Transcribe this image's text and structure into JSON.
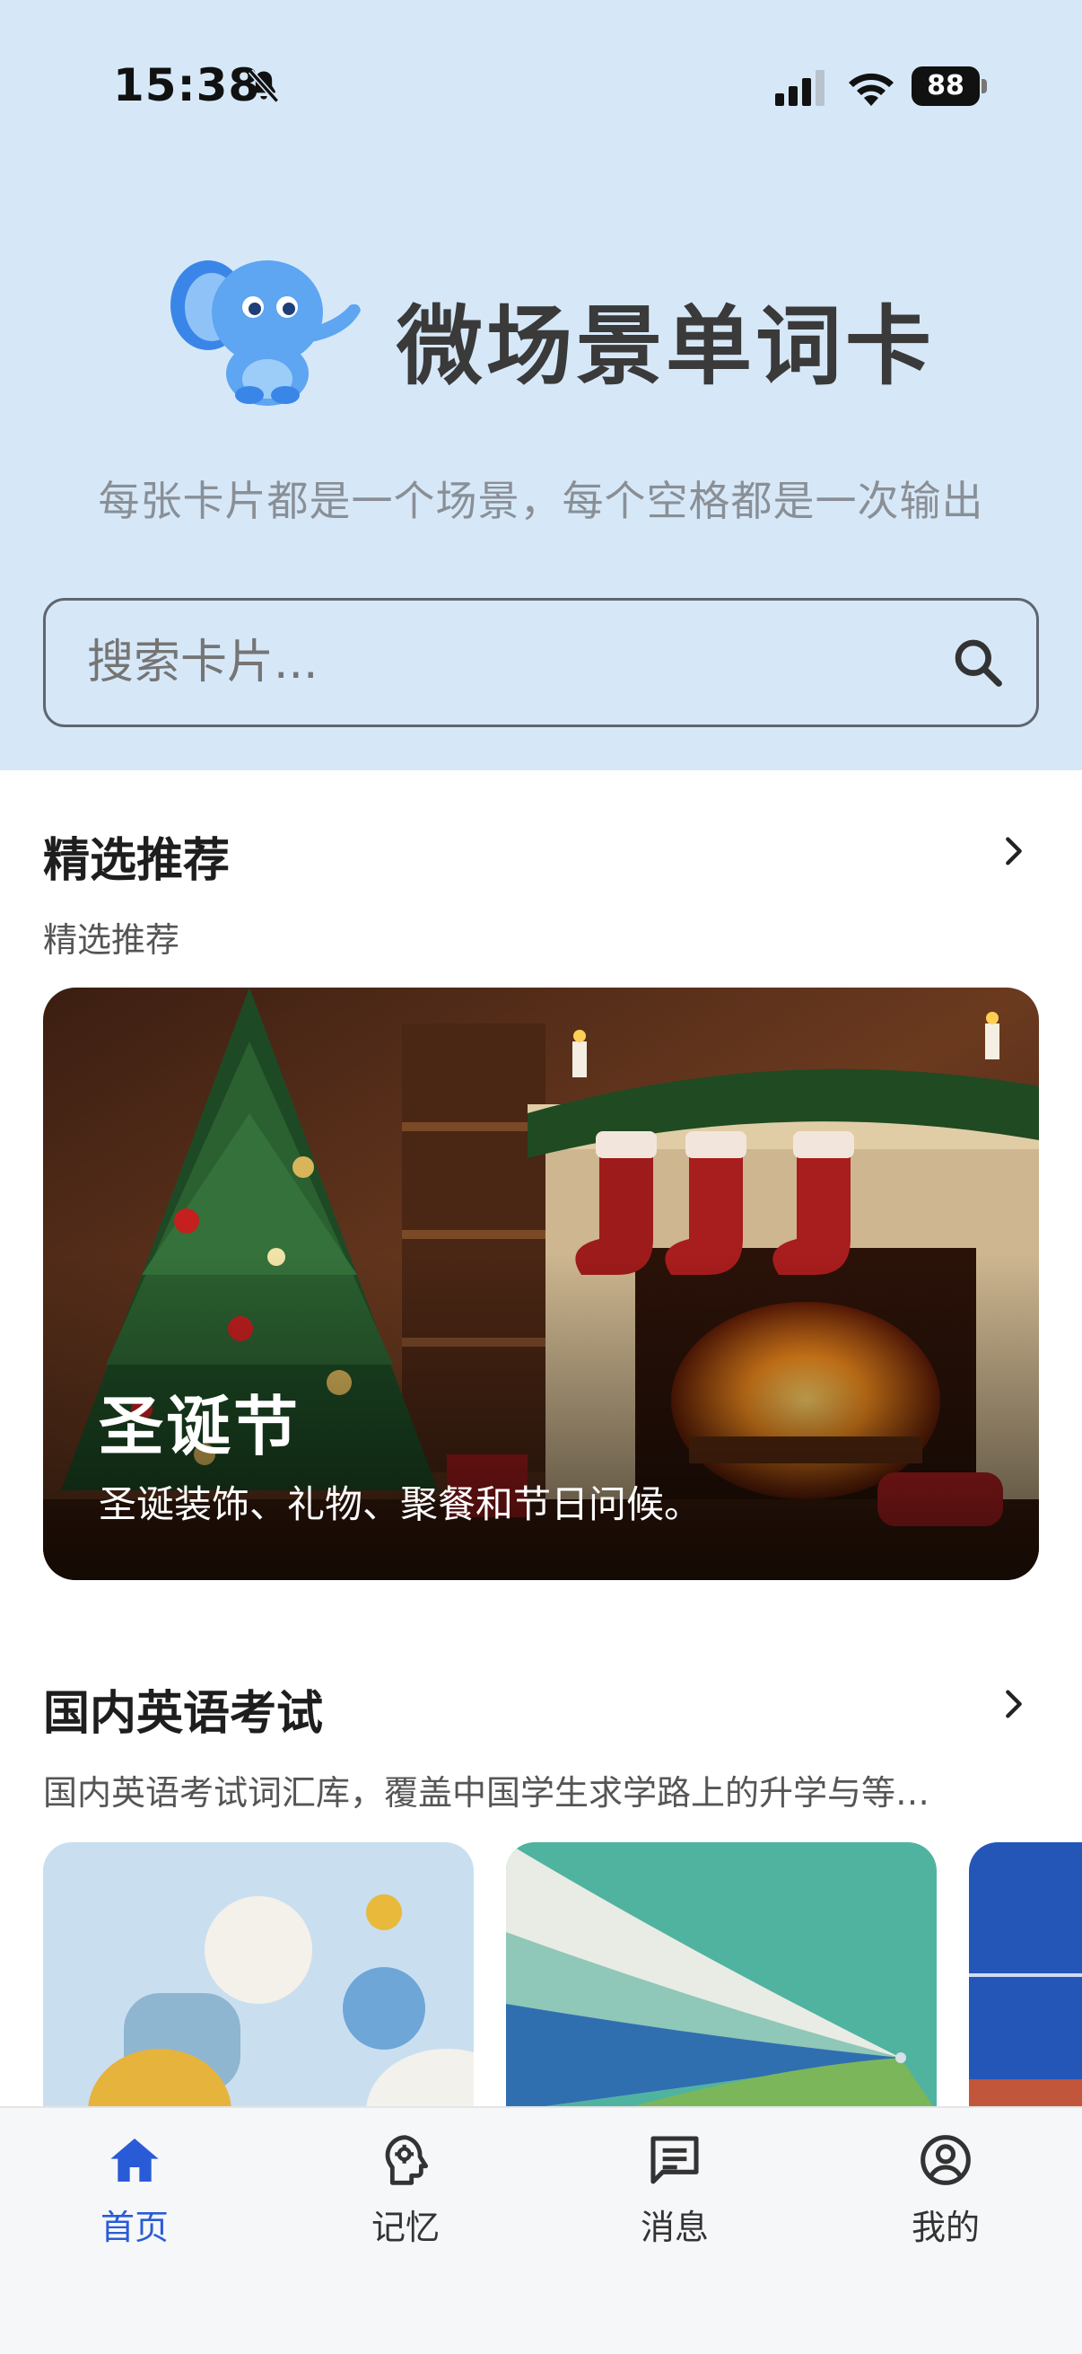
{
  "status_bar": {
    "time": "15:38",
    "battery": "88",
    "icons": [
      "bell-slash-icon",
      "signal-icon",
      "wifi-icon",
      "battery-icon"
    ]
  },
  "header": {
    "logo": "elephant-logo",
    "app_title": "微场景单词卡",
    "tagline": "每张卡片都是一个场景，每个空格都是一次输出"
  },
  "search": {
    "placeholder": "搜索卡片...",
    "icon": "search-icon"
  },
  "featured": {
    "title": "精选推荐",
    "subtitle": "精选推荐",
    "card": {
      "title": "圣诞节",
      "description": "圣诞装饰、礼物、聚餐和节日问候。"
    }
  },
  "exam_section": {
    "title": "国内英语考试",
    "subtitle": "国内英语考试词汇库，覆盖中国学生求学路上的升学与等…"
  },
  "nav": {
    "items": [
      {
        "label": "首页",
        "icon": "home-icon",
        "active": true
      },
      {
        "label": "记忆",
        "icon": "brain-icon",
        "active": false
      },
      {
        "label": "消息",
        "icon": "message-icon",
        "active": false
      },
      {
        "label": "我的",
        "icon": "user-icon",
        "active": false
      }
    ]
  },
  "colors": {
    "hero_bg": "#d6e8f8",
    "accent": "#2a5bd7"
  }
}
